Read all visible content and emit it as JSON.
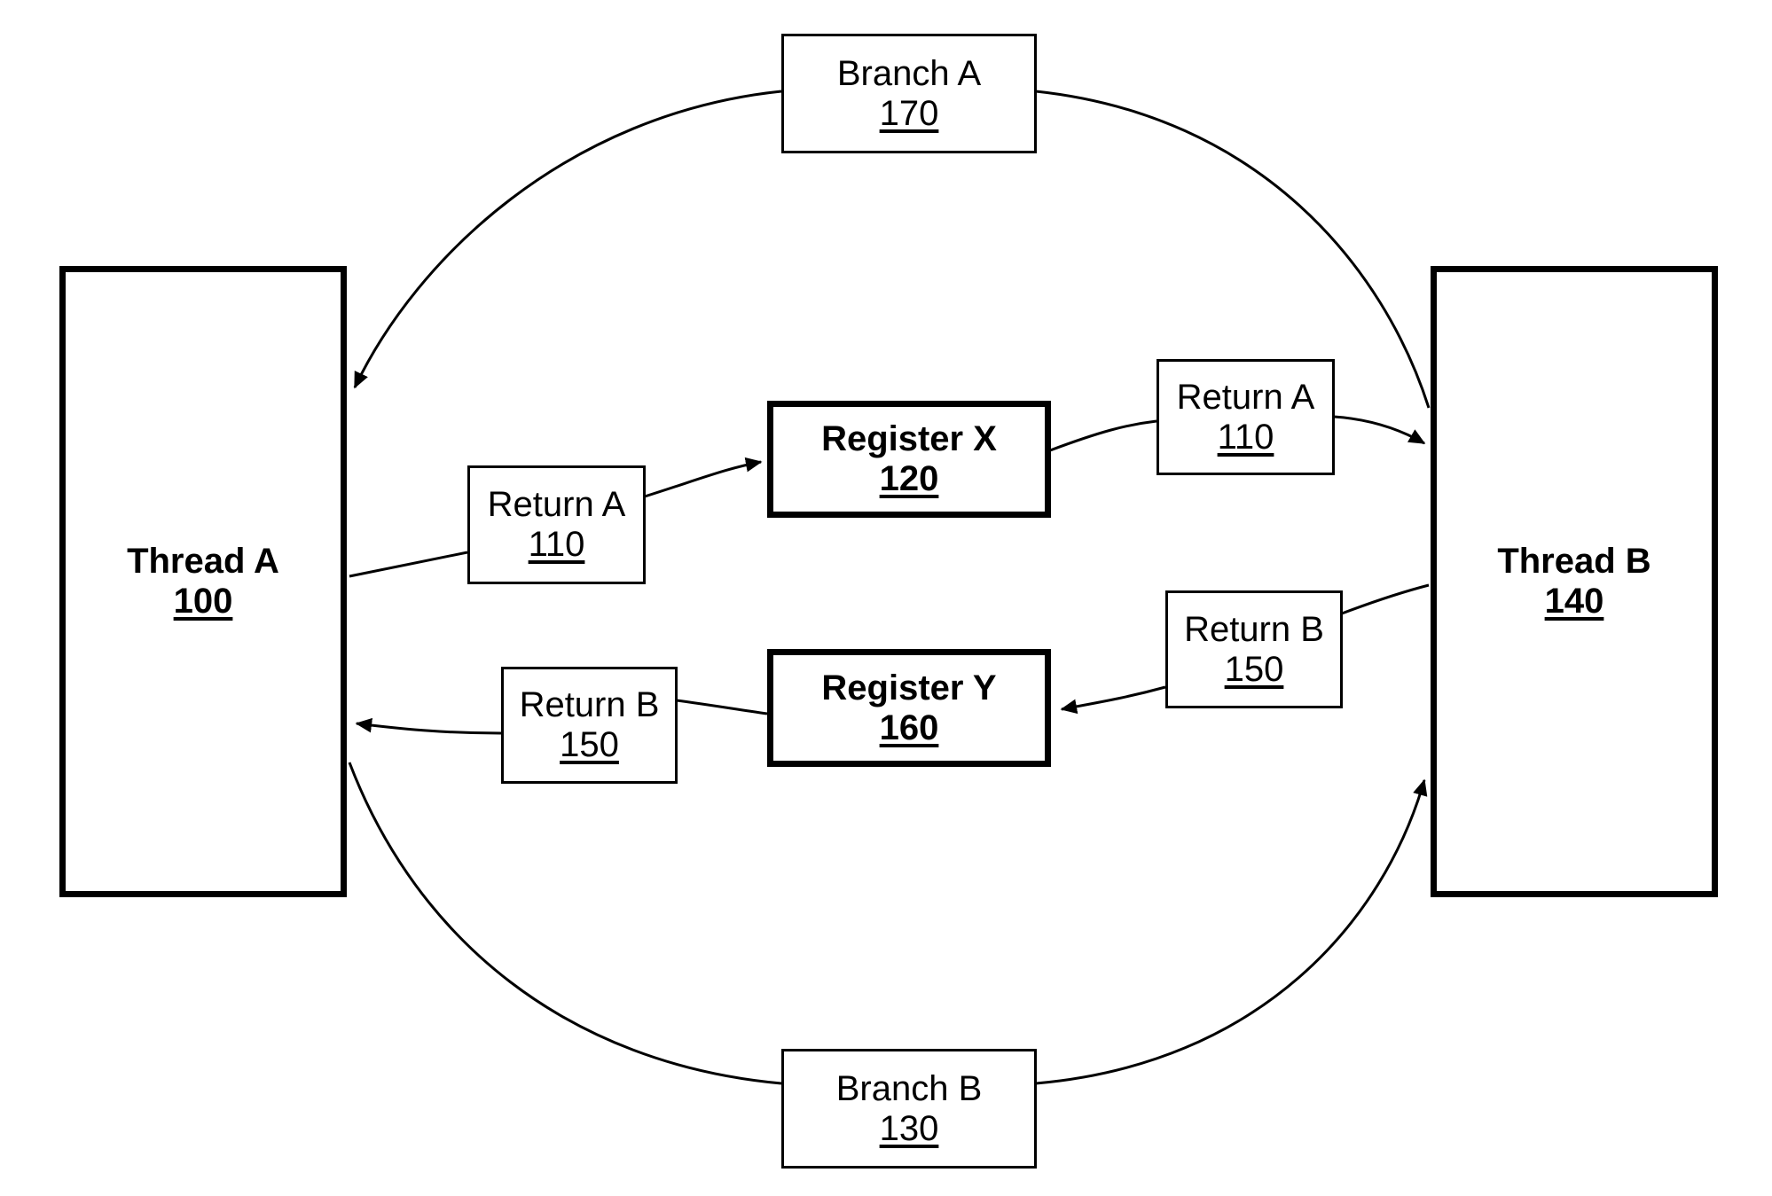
{
  "diagram": {
    "type": "patent-block-diagram",
    "background_color": "#ffffff",
    "line_color": "#000000",
    "nodes": {
      "thread_a": {
        "title": "Thread A",
        "ref": "100",
        "emphasis": "thick"
      },
      "thread_b": {
        "title": "Thread B",
        "ref": "140",
        "emphasis": "thick"
      },
      "register_x": {
        "title": "Register X",
        "ref": "120",
        "emphasis": "thick"
      },
      "register_y": {
        "title": "Register Y",
        "ref": "160",
        "emphasis": "thick"
      },
      "branch_a": {
        "title": "Branch A",
        "ref": "170",
        "emphasis": "thin"
      },
      "branch_b": {
        "title": "Branch B",
        "ref": "130",
        "emphasis": "thin"
      },
      "return_a_left": {
        "title": "Return A",
        "ref": "110",
        "emphasis": "thin"
      },
      "return_a_right": {
        "title": "Return A",
        "ref": "110",
        "emphasis": "thin"
      },
      "return_b_left": {
        "title": "Return B",
        "ref": "150",
        "emphasis": "thin"
      },
      "return_b_right": {
        "title": "Return B",
        "ref": "150",
        "emphasis": "thin"
      }
    },
    "edges": [
      {
        "name": "branch-a-to-thread-a",
        "from": "branch_a",
        "to": "thread_a",
        "arrow": true
      },
      {
        "name": "thread-b-to-branch-a",
        "from": "thread_b",
        "to": "branch_a",
        "arrow": false
      },
      {
        "name": "thread-a-to-return-a",
        "from": "thread_a",
        "to": "return_a_left",
        "arrow": false
      },
      {
        "name": "return-a-to-register-x",
        "from": "return_a_left",
        "to": "register_x",
        "arrow": true
      },
      {
        "name": "register-x-to-return-a",
        "from": "register_x",
        "to": "return_a_right",
        "arrow": false
      },
      {
        "name": "return-a-to-thread-b",
        "from": "return_a_right",
        "to": "thread_b",
        "arrow": true
      },
      {
        "name": "thread-b-to-return-b",
        "from": "thread_b",
        "to": "return_b_right",
        "arrow": false
      },
      {
        "name": "return-b-to-register-y",
        "from": "return_b_right",
        "to": "register_y",
        "arrow": true
      },
      {
        "name": "register-y-to-return-b",
        "from": "register_y",
        "to": "return_b_left",
        "arrow": false
      },
      {
        "name": "return-b-to-thread-a",
        "from": "return_b_left",
        "to": "thread_a",
        "arrow": true
      },
      {
        "name": "thread-a-to-branch-b",
        "from": "thread_a",
        "to": "branch_b",
        "arrow": false
      },
      {
        "name": "branch-b-to-thread-b",
        "from": "branch_b",
        "to": "thread_b",
        "arrow": true
      }
    ]
  }
}
